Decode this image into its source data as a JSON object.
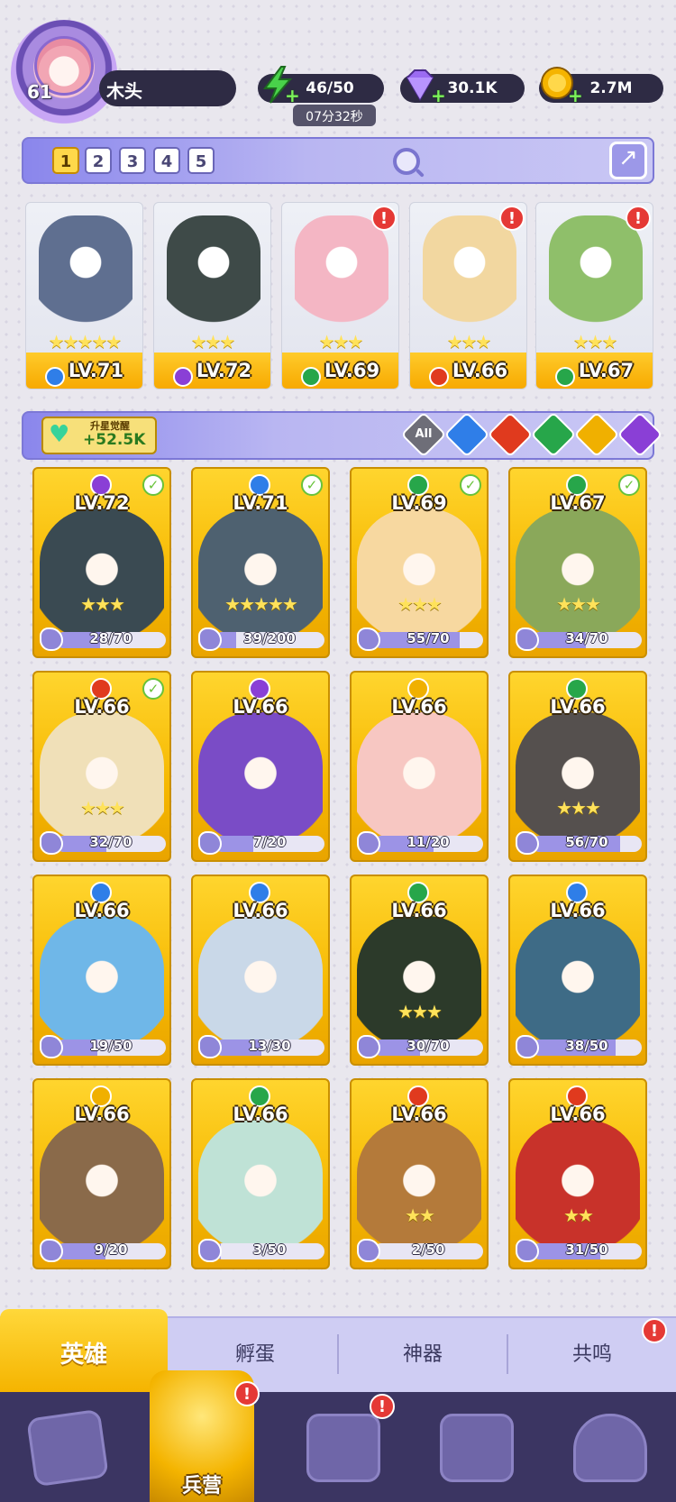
{
  "player": {
    "level": "61",
    "name": "木头",
    "avatar_icon": "avatar-portrait-icon"
  },
  "resources": {
    "energy": {
      "value": "46/50",
      "timer": "07分32秒",
      "icon": "lightning-icon",
      "color": "#49d24a"
    },
    "gems": {
      "value": "30.1K",
      "icon": "diamond-icon",
      "color": "#9b6bf2"
    },
    "gold": {
      "value": "2.7M",
      "icon": "gold-coin-icon",
      "color": "#f5b400"
    }
  },
  "team_tabs": [
    "1",
    "2",
    "3",
    "4",
    "5"
  ],
  "team_active_index": 0,
  "team": [
    {
      "level": "LV.71",
      "stars": "★★★★★",
      "element": "water",
      "elem_color": "#2f7ee8",
      "art": "#5f6f90",
      "alert": false
    },
    {
      "level": "LV.72",
      "stars": "★★★",
      "element": "dark",
      "elem_color": "#8a3fd6",
      "art": "#3e4a48",
      "alert": false
    },
    {
      "level": "LV.69",
      "stars": "★★★",
      "element": "wind",
      "elem_color": "#27a64a",
      "art": "#f4b6c4",
      "alert": true
    },
    {
      "level": "LV.66",
      "stars": "★★★",
      "element": "fire",
      "elem_color": "#e03a1e",
      "art": "#f2d7a0",
      "alert": true
    },
    {
      "level": "LV.67",
      "stars": "★★★",
      "element": "wind",
      "elem_color": "#27a64a",
      "art": "#8fbf6a",
      "alert": true
    }
  ],
  "awaken": {
    "label": "升星觉醒",
    "value": "+52.5K",
    "icon": "heart-icon"
  },
  "filters": [
    {
      "label": "All",
      "color": "#6e6e78"
    },
    {
      "label": "",
      "color": "#2f7ee8",
      "name": "water"
    },
    {
      "label": "",
      "color": "#e03a1e",
      "name": "fire"
    },
    {
      "label": "",
      "color": "#27a64a",
      "name": "wind"
    },
    {
      "label": "",
      "color": "#f0b000",
      "name": "light"
    },
    {
      "label": "",
      "color": "#8a3fd6",
      "name": "dark"
    }
  ],
  "heroes": [
    {
      "level": "LV.72",
      "stars": "★★★",
      "frag": "28/70",
      "progress": 0.4,
      "elem_color": "#8a3fd6",
      "check": true,
      "art": "#3a4a52"
    },
    {
      "level": "LV.71",
      "stars": "★★★★★",
      "frag": "39/200",
      "progress": 0.2,
      "elem_color": "#2f7ee8",
      "check": true,
      "art": "#4e6170"
    },
    {
      "level": "LV.69",
      "stars": "★★★",
      "frag": "55/70",
      "progress": 0.79,
      "elem_color": "#27a64a",
      "check": true,
      "art": "#f7d8a0"
    },
    {
      "level": "LV.67",
      "stars": "★★★",
      "frag": "34/70",
      "progress": 0.49,
      "elem_color": "#27a64a",
      "check": true,
      "art": "#8aa85a"
    },
    {
      "level": "LV.66",
      "stars": "★★★",
      "frag": "32/70",
      "progress": 0.46,
      "elem_color": "#e03a1e",
      "check": true,
      "art": "#f0e0b8"
    },
    {
      "level": "LV.66",
      "stars": "",
      "frag": "7/20",
      "progress": 0.35,
      "elem_color": "#8a3fd6",
      "check": false,
      "art": "#7a4cc6"
    },
    {
      "level": "LV.66",
      "stars": "",
      "frag": "11/20",
      "progress": 0.55,
      "elem_color": "#f0b000",
      "check": false,
      "art": "#f7c7c2"
    },
    {
      "level": "LV.66",
      "stars": "★★★",
      "frag": "56/70",
      "progress": 0.8,
      "elem_color": "#27a64a",
      "check": false,
      "art": "#55504e"
    },
    {
      "level": "LV.66",
      "stars": "",
      "frag": "19/50",
      "progress": 0.38,
      "elem_color": "#2f7ee8",
      "check": false,
      "art": "#6fb7e8"
    },
    {
      "level": "LV.66",
      "stars": "",
      "frag": "13/30",
      "progress": 0.43,
      "elem_color": "#2f7ee8",
      "check": false,
      "art": "#c9d8e8"
    },
    {
      "level": "LV.66",
      "stars": "★★★",
      "frag": "30/70",
      "progress": 0.43,
      "elem_color": "#27a64a",
      "check": false,
      "art": "#2c3a2a"
    },
    {
      "level": "LV.66",
      "stars": "",
      "frag": "38/50",
      "progress": 0.76,
      "elem_color": "#2f7ee8",
      "check": false,
      "art": "#3e6b86"
    },
    {
      "level": "LV.66",
      "stars": "",
      "frag": "9/20",
      "progress": 0.45,
      "elem_color": "#f0b000",
      "check": false,
      "art": "#8a6a4a"
    },
    {
      "level": "LV.66",
      "stars": "",
      "frag": "3/50",
      "progress": 0.06,
      "elem_color": "#27a64a",
      "check": false,
      "art": "#bfe2d6"
    },
    {
      "level": "LV.66",
      "stars": "★★",
      "frag": "2/50",
      "progress": 0.04,
      "elem_color": "#e03a1e",
      "check": false,
      "art": "#b47a3a"
    },
    {
      "level": "LV.66",
      "stars": "★★",
      "frag": "31/50",
      "progress": 0.62,
      "elem_color": "#e03a1e",
      "check": false,
      "art": "#c8322a"
    }
  ],
  "sub_tabs": [
    {
      "label": "英雄",
      "active": true
    },
    {
      "label": "孵蛋",
      "active": false
    },
    {
      "label": "神器",
      "active": false
    },
    {
      "label": "共鸣",
      "active": false,
      "alert": true
    }
  ],
  "nav": [
    {
      "icon": "cards-icon",
      "label": ""
    },
    {
      "icon": "barracks-icon",
      "label": "兵营",
      "active": true,
      "alert": true
    },
    {
      "icon": "map-book-icon",
      "label": "",
      "alert": true
    },
    {
      "icon": "temple-icon",
      "label": ""
    },
    {
      "icon": "mushroom-house-icon",
      "label": ""
    }
  ],
  "alert_mark": "!",
  "check_mark": "✓"
}
